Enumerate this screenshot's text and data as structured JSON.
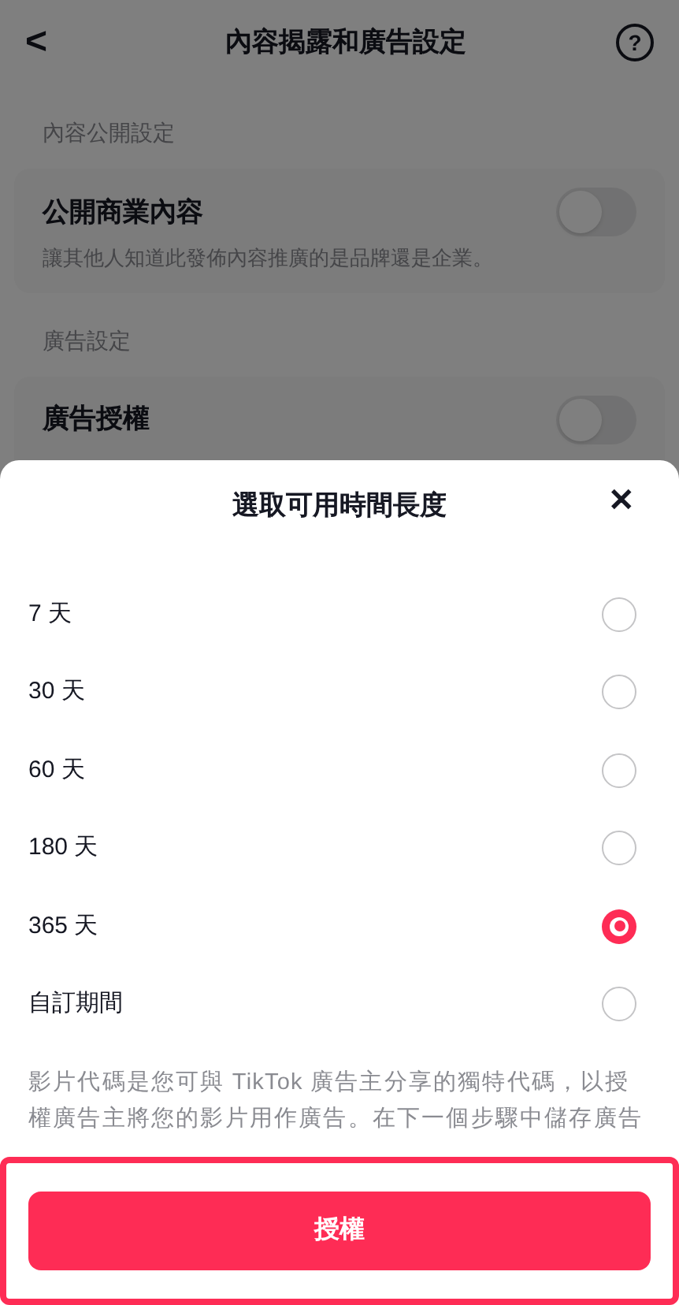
{
  "header": {
    "back": "<",
    "title": "內容揭露和廣告設定",
    "help": "?"
  },
  "sections": [
    {
      "label": "內容公開設定",
      "title": "公開商業內容",
      "description": "讓其他人知道此發佈內容推廣的是品牌還是企業。",
      "on": false
    },
    {
      "label": "廣告設定",
      "title": "廣告授權",
      "on": false
    }
  ],
  "sheet": {
    "title": "選取可用時間長度",
    "close": "✕",
    "options": [
      {
        "label": "7 天",
        "selected": false
      },
      {
        "label": "30 天",
        "selected": false
      },
      {
        "label": "60 天",
        "selected": false
      },
      {
        "label": "180 天",
        "selected": false
      },
      {
        "label": "365 天",
        "selected": true
      },
      {
        "label": "自訂期間",
        "selected": false
      }
    ],
    "description": "影片代碼是您可與 TikTok 廣告主分享的獨特代碼，以授權廣告主將您的影片用作廣告。在下一個步驟中儲存廣告",
    "button": "授權"
  }
}
